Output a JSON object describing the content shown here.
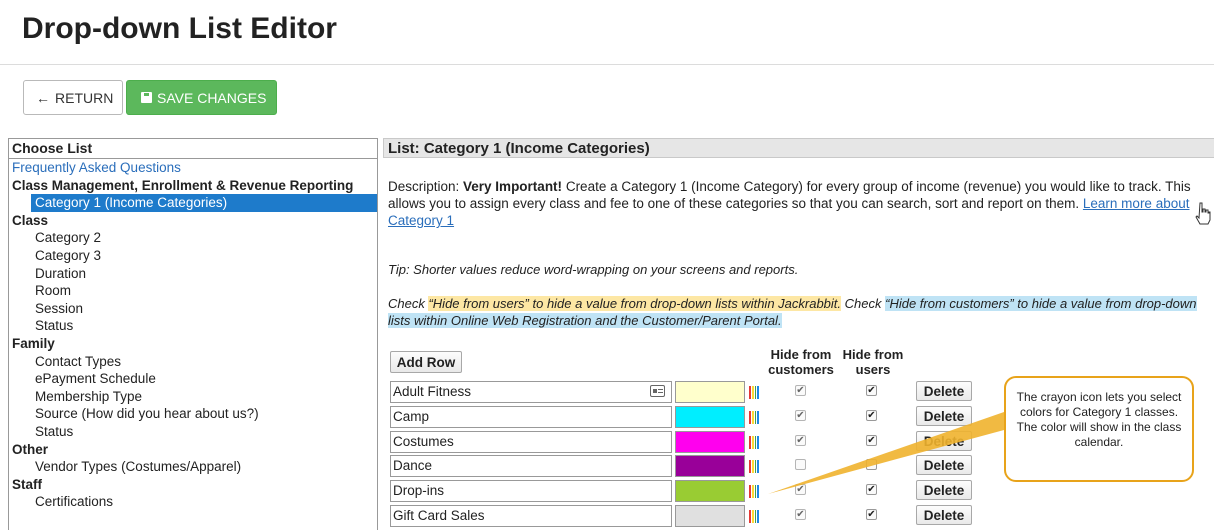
{
  "header": {
    "title": "Drop-down List Editor"
  },
  "toolbar": {
    "return_label": "RETURN",
    "save_label": "SAVE CHANGES"
  },
  "left_panel": {
    "heading": "Choose List",
    "items": [
      {
        "kind": "link",
        "label": "Frequently Asked Questions"
      },
      {
        "kind": "group",
        "label": "Class Management, Enrollment & Revenue Reporting"
      },
      {
        "kind": "item-selected",
        "label": "Category 1 (Income Categories)"
      },
      {
        "kind": "group",
        "label": "Class"
      },
      {
        "kind": "item",
        "label": "Category 2"
      },
      {
        "kind": "item",
        "label": "Category 3"
      },
      {
        "kind": "item",
        "label": "Duration"
      },
      {
        "kind": "item",
        "label": "Room"
      },
      {
        "kind": "item",
        "label": "Session"
      },
      {
        "kind": "item",
        "label": "Status"
      },
      {
        "kind": "group",
        "label": "Family"
      },
      {
        "kind": "item",
        "label": "Contact Types"
      },
      {
        "kind": "item",
        "label": "ePayment Schedule"
      },
      {
        "kind": "item",
        "label": "Membership Type"
      },
      {
        "kind": "item",
        "label": "Source (How did you hear about us?)"
      },
      {
        "kind": "item",
        "label": "Status"
      },
      {
        "kind": "group",
        "label": "Other"
      },
      {
        "kind": "item",
        "label": "Vendor Types (Costumes/Apparel)"
      },
      {
        "kind": "group",
        "label": "Staff"
      },
      {
        "kind": "item",
        "label": "Certifications"
      }
    ]
  },
  "list": {
    "heading": "List: Category 1 (Income Categories)",
    "desc_prefix": "Description: ",
    "desc_bold": "Very Important!",
    "desc_text": " Create a Category 1 (Income Category) for every group of income (revenue) you would like to track. This allows you to assign every class and fee to one of these categories so that you can search, sort and report on them. ",
    "learn_more": "Learn more about Category 1",
    "tip": "Tip: Shorter values reduce word-wrapping on your screens and reports.",
    "check_prefix": "Check ",
    "check_users": "“Hide from users” to hide a value from drop-down lists within Jackrabbit.",
    "check_mid": " Check ",
    "check_customers": "“Hide from customers” to hide a value from drop-down lists within Online Web Registration and the Customer/Parent Portal.",
    "add_row_label": "Add Row",
    "col_customers": "Hide from customers",
    "col_users": "Hide from users",
    "delete_label": "Delete",
    "rows": [
      {
        "value": "Adult Fitness",
        "color": "#ffffcc",
        "hide_customers": true,
        "hide_users": true
      },
      {
        "value": "Camp",
        "color": "#00eeff",
        "hide_customers": true,
        "hide_users": true
      },
      {
        "value": "Costumes",
        "color": "#ff00ee",
        "hide_customers": true,
        "hide_users": true
      },
      {
        "value": "Dance",
        "color": "#990099",
        "hide_customers": false,
        "hide_users": false
      },
      {
        "value": "Drop-ins",
        "color": "#99cc33",
        "hide_customers": true,
        "hide_users": true
      },
      {
        "value": "Gift Card Sales",
        "color": "#e0e0e0",
        "hide_customers": true,
        "hide_users": true
      }
    ]
  },
  "callout": {
    "line1": "The crayon icon lets you select colors for Category 1 classes.",
    "line2": "The color will show in the class calendar."
  }
}
